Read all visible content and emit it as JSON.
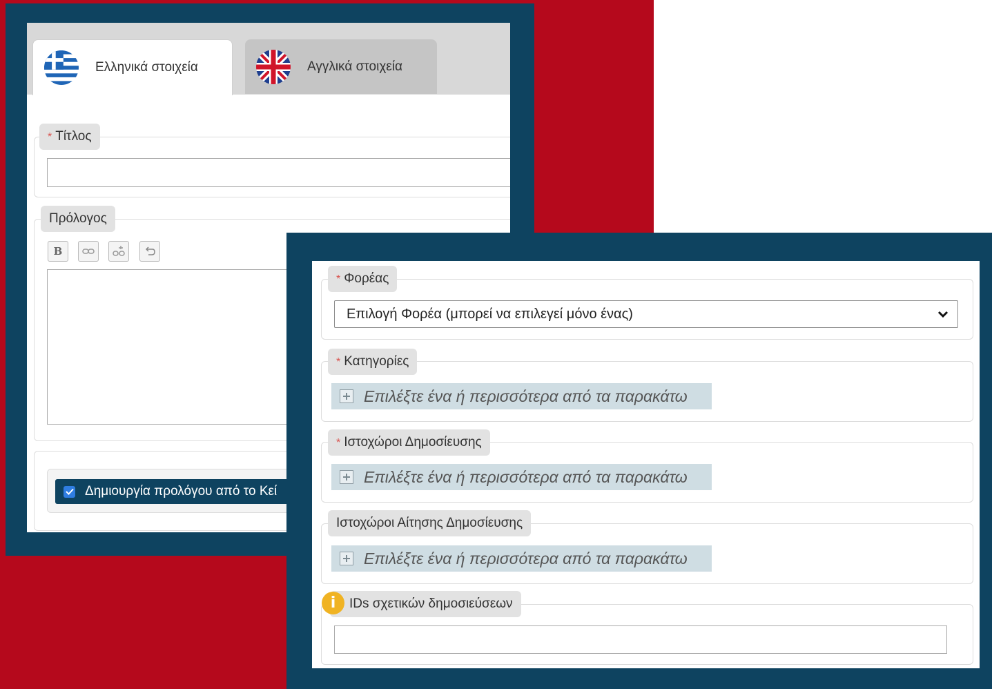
{
  "tabs": [
    {
      "label": "Ελληνικά στοιχεία",
      "flag": "greek-flag-icon",
      "active": true
    },
    {
      "label": "Αγγλικά στοιχεία",
      "flag": "uk-flag-icon",
      "active": false
    }
  ],
  "form_greek": {
    "title_field": {
      "label": "Τίτλος",
      "required_mark": "*",
      "value": ""
    },
    "prologue_field": {
      "label": "Πρόλογος",
      "toolbar": [
        "bold-icon",
        "link-icon",
        "unlink-icon",
        "undo-icon"
      ],
      "bold_glyph": "B",
      "value": ""
    },
    "checkbox": {
      "label": "Δημιουργία προλόγου από το Κεί",
      "checked": true
    }
  },
  "form_details": {
    "organization": {
      "label": "Φορέας",
      "required_mark": "*",
      "selected": "Επιλογή Φορέα (μπορεί να επιλεγεί μόνο ένας)"
    },
    "categories": {
      "label": "Κατηγορίες",
      "required_mark": "*",
      "placeholder": "Επιλέξτε ένα ή περισσότερα από τα παρακάτω"
    },
    "publish_sites": {
      "label": "Ιστοχώροι Δημοσίευσης",
      "required_mark": "*",
      "placeholder": "Επιλέξτε ένα ή περισσότερα από τα παρακάτω"
    },
    "request_sites": {
      "label": "Ιστοχώροι Αίτησης Δημοσίευσης",
      "placeholder": "Επιλέξτε ένα ή περισσότερα από τα παρακάτω"
    },
    "related_ids": {
      "label": "IDs σχετικών δημοσιεύσεων",
      "info_glyph": "i",
      "value": ""
    }
  },
  "colors": {
    "red": "#b5091c",
    "navy": "#0e4360",
    "checkbox_blue": "#2f7de1",
    "info_yellow": "#f0b323"
  }
}
